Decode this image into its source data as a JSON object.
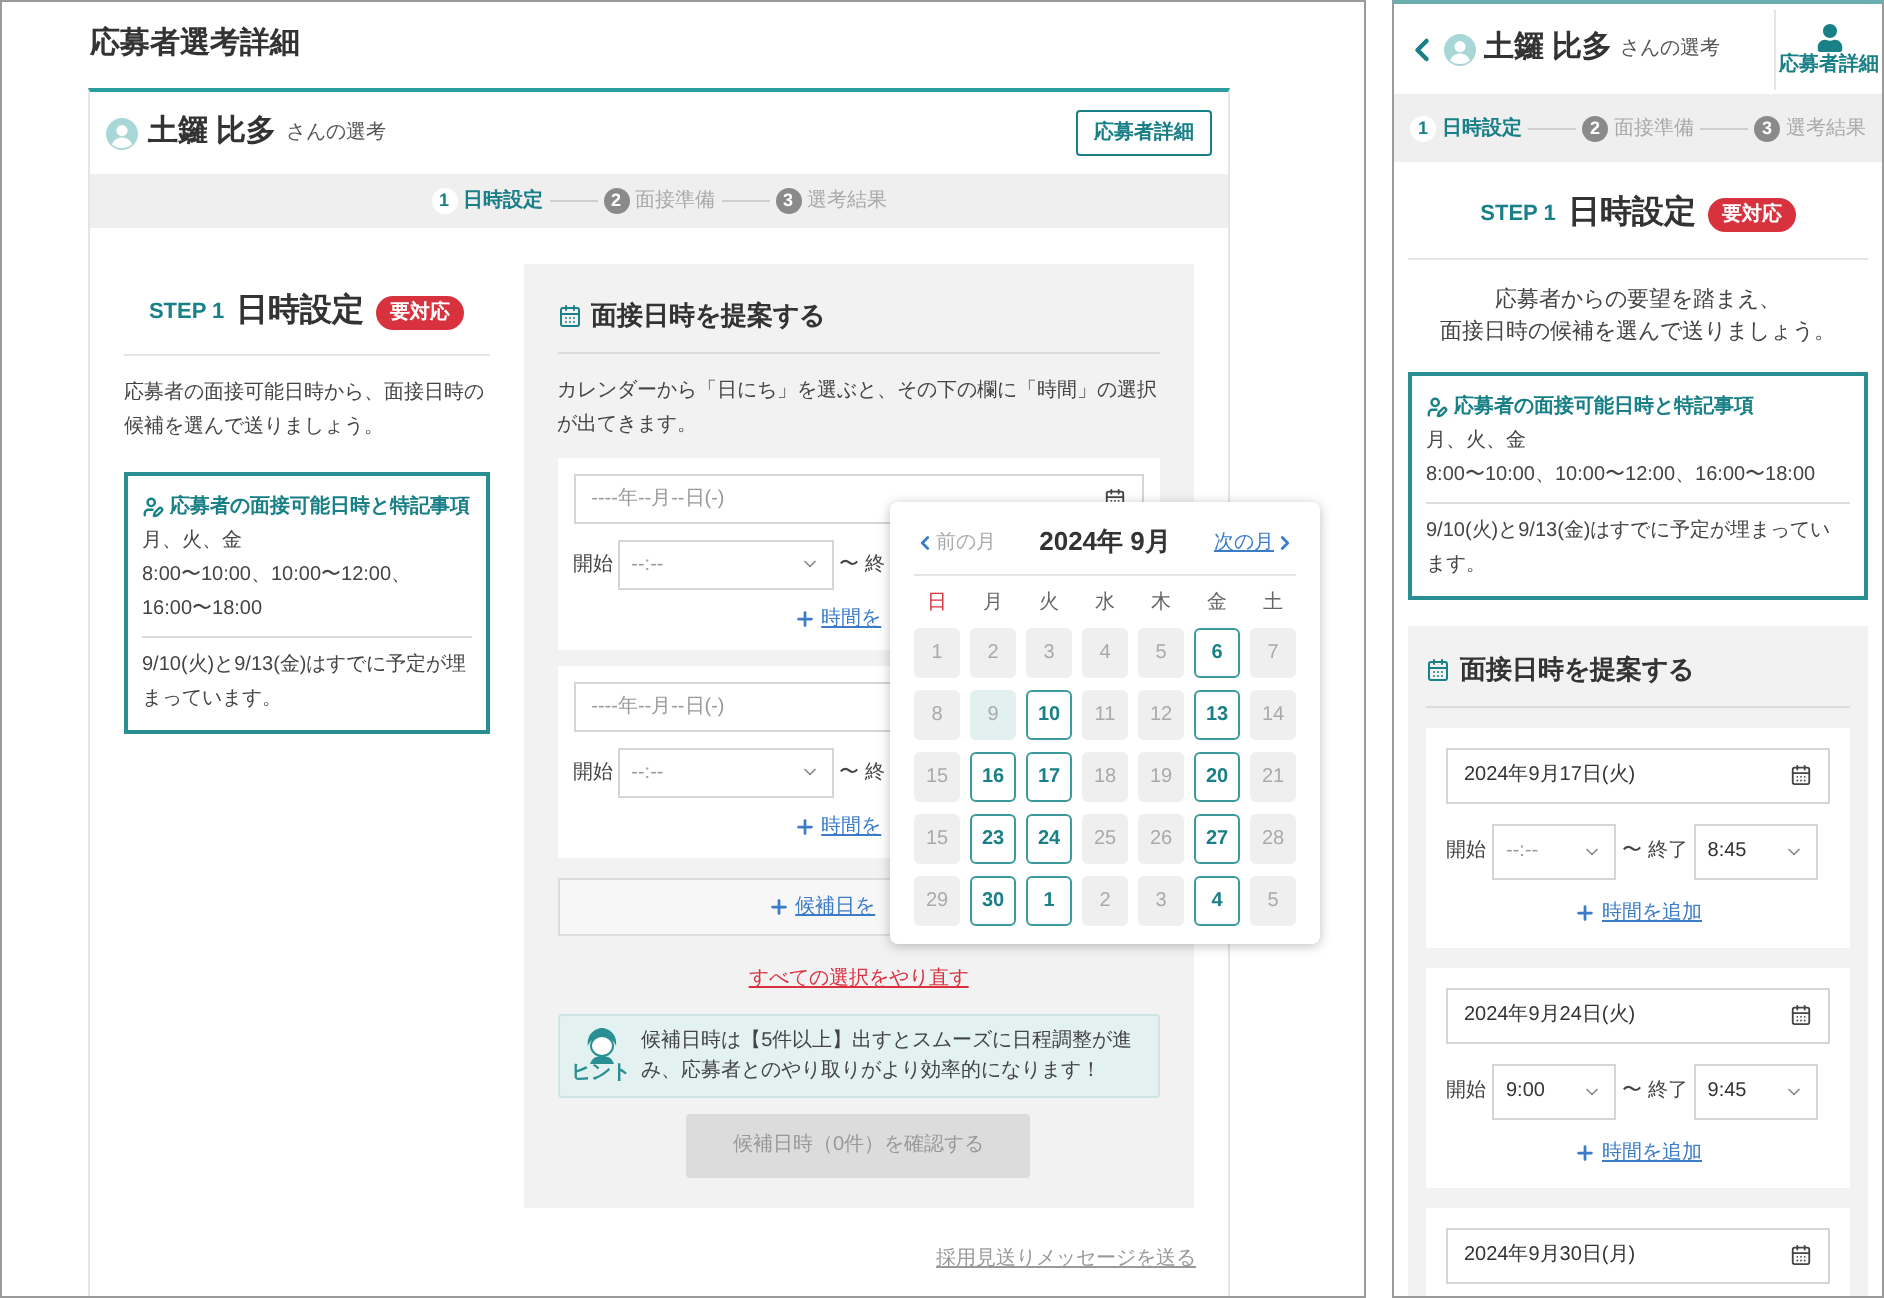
{
  "desktop": {
    "page_title": "応募者選考詳細",
    "applicant": {
      "name": "土鑼 比多",
      "suffix": "さんの選考"
    },
    "detail_button": "応募者詳細",
    "steps": [
      {
        "number": "1",
        "label": "日時設定",
        "selected": true
      },
      {
        "number": "2",
        "label": "面接準備",
        "selected": false
      },
      {
        "number": "3",
        "label": "選考結果",
        "selected": false
      }
    ],
    "step_heading": {
      "step": "STEP 1",
      "title": "日時設定",
      "badge": "要対応"
    },
    "intro": "応募者の面接可能日時から、面接日時の候補を選んで送りましょう。",
    "availability": {
      "title": "応募者の面接可能日時と特記事項",
      "days": "月、火、金",
      "times": "8:00〜10:00、10:00〜12:00、16:00〜18:00",
      "note": "9/10(火)と9/13(金)はすでに予定が埋まっています。"
    },
    "proposal": {
      "title": "面接日時を提案する",
      "description": "カレンダーから「日にち」を選ぶと、その下の欄に「時間」の選択が出てきます。",
      "slots": [
        {
          "date": {
            "placeholder": "----年--月--日(-)"
          },
          "calendar_icon": true,
          "start_label": "開始",
          "start": {
            "placeholder": "--:--"
          },
          "end_label": "〜 終",
          "add_time": "時間を"
        },
        {
          "date": {
            "placeholder": "----年--月--日(-)"
          },
          "start_label": "開始",
          "start": {
            "placeholder": "--:--"
          },
          "end_label": "〜 終",
          "add_time": "時間を"
        }
      ],
      "add_date": "候補日を",
      "reset": "すべての選択をやり直す",
      "hint": {
        "badge": "ヒント",
        "text": "候補日時は【5件以上】出すとスムーズに日程調整が進み、応募者とのやり取りがより効率的になります！"
      },
      "confirm": {
        "label": "候補日時（0件）を確認する",
        "disabled": true
      }
    },
    "decline_link": "採用見送りメッセージを送る",
    "calendar": {
      "prev": "前の月",
      "title": "2024年 9月",
      "next": "次の月",
      "weekdays": [
        {
          "label": "日",
          "kind": "sunday"
        },
        {
          "label": "月",
          "kind": "weekday"
        },
        {
          "label": "火",
          "kind": "weekday"
        },
        {
          "label": "水",
          "kind": "weekday"
        },
        {
          "label": "木",
          "kind": "weekday"
        },
        {
          "label": "金",
          "kind": "weekday"
        },
        {
          "label": "土",
          "kind": "weekday"
        }
      ],
      "days": [
        {
          "label": "1",
          "kind": "disabled"
        },
        {
          "label": "2",
          "kind": "disabled"
        },
        {
          "label": "3",
          "kind": "disabled"
        },
        {
          "label": "4",
          "kind": "disabled"
        },
        {
          "label": "5",
          "kind": "disabled"
        },
        {
          "label": "6",
          "kind": "available"
        },
        {
          "label": "7",
          "kind": "disabled"
        },
        {
          "label": "8",
          "kind": "disabled"
        },
        {
          "label": "9",
          "kind": "today"
        },
        {
          "label": "10",
          "kind": "available"
        },
        {
          "label": "11",
          "kind": "disabled"
        },
        {
          "label": "12",
          "kind": "disabled"
        },
        {
          "label": "13",
          "kind": "available"
        },
        {
          "label": "14",
          "kind": "disabled"
        },
        {
          "label": "15",
          "kind": "disabled"
        },
        {
          "label": "16",
          "kind": "available"
        },
        {
          "label": "17",
          "kind": "available"
        },
        {
          "label": "18",
          "kind": "disabled"
        },
        {
          "label": "19",
          "kind": "disabled"
        },
        {
          "label": "20",
          "kind": "available"
        },
        {
          "label": "21",
          "kind": "disabled"
        },
        {
          "label": "15",
          "kind": "disabled"
        },
        {
          "label": "23",
          "kind": "available"
        },
        {
          "label": "24",
          "kind": "available"
        },
        {
          "label": "25",
          "kind": "disabled"
        },
        {
          "label": "26",
          "kind": "disabled"
        },
        {
          "label": "27",
          "kind": "available"
        },
        {
          "label": "28",
          "kind": "disabled"
        },
        {
          "label": "29",
          "kind": "disabled"
        },
        {
          "label": "30",
          "kind": "available"
        },
        {
          "label": "1",
          "kind": "available"
        },
        {
          "label": "2",
          "kind": "disabled"
        },
        {
          "label": "3",
          "kind": "disabled"
        },
        {
          "label": "4",
          "kind": "available"
        },
        {
          "label": "5",
          "kind": "disabled"
        }
      ]
    }
  },
  "mobile": {
    "applicant": {
      "name": "土鑼 比多",
      "suffix": "さんの選考"
    },
    "detail_button": "応募者詳細",
    "steps": [
      {
        "number": "1",
        "label": "日時設定",
        "selected": true
      },
      {
        "number": "2",
        "label": "面接準備",
        "selected": false
      },
      {
        "number": "3",
        "label": "選考結果",
        "selected": false
      }
    ],
    "step_heading": {
      "step": "STEP 1",
      "title": "日時設定",
      "badge": "要対応"
    },
    "intro_lines": [
      "応募者からの要望を踏まえ、",
      "面接日時の候補を選んで送りましょう。"
    ],
    "availability": {
      "title": "応募者の面接可能日時と特記事項",
      "days": "月、火、金",
      "times": "8:00〜10:00、10:00〜12:00、16:00〜18:00",
      "note": "9/10(火)と9/13(金)はすでに予定が埋まっています。"
    },
    "proposal": {
      "title": "面接日時を提案する",
      "slots": [
        {
          "date": {
            "value": "2024年9月17日(火)"
          },
          "start_label": "開始",
          "start": {
            "placeholder": "--:--"
          },
          "end_label": "〜 終了",
          "end": {
            "value": "8:45"
          },
          "add_time": "時間を追加"
        },
        {
          "date": {
            "value": "2024年9月24日(火)"
          },
          "start_label": "開始",
          "start": {
            "value": "9:00"
          },
          "end_label": "〜 終了",
          "end": {
            "value": "9:45"
          },
          "add_time": "時間を追加"
        },
        {
          "date": {
            "value": "2024年9月30日(月)"
          }
        }
      ]
    }
  }
}
